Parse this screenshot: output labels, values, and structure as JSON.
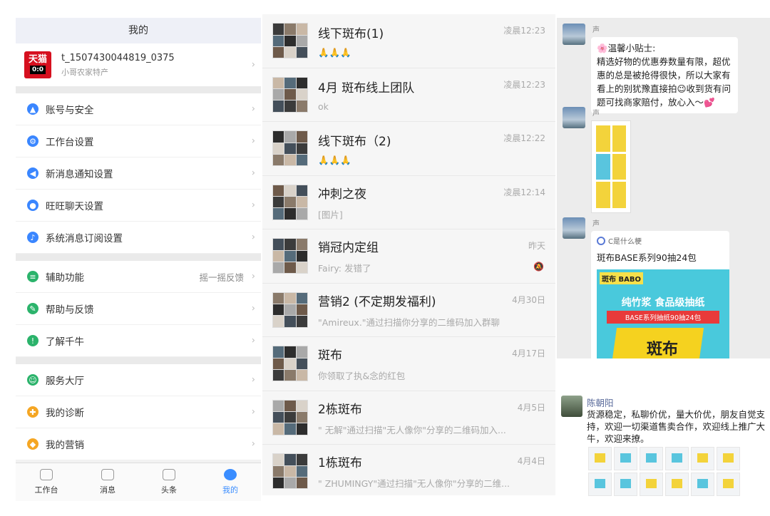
{
  "settings": {
    "title": "我的",
    "account": {
      "id": "t_1507430044819_0375",
      "subtitle": "小哥农家特产",
      "logo_text_top": "天猫",
      "logo_text_bottom": "0:0"
    },
    "group1": [
      {
        "label": "账号与安全",
        "icon": "warning-triangle-icon",
        "color": "#3a86ff"
      },
      {
        "label": "工作台设置",
        "icon": "gear-icon",
        "color": "#3a86ff"
      },
      {
        "label": "新消息通知设置",
        "icon": "speaker-icon",
        "color": "#3a86ff"
      },
      {
        "label": "旺旺聊天设置",
        "icon": "chat-bubble-icon",
        "color": "#3a86ff"
      },
      {
        "label": "系统消息订阅设置",
        "icon": "bell-icon",
        "color": "#3a86ff"
      }
    ],
    "group2": [
      {
        "label": "辅助功能",
        "icon": "assist-icon",
        "color": "#2bb36b",
        "extra": "摇一摇反馈"
      },
      {
        "label": "帮助与反馈",
        "icon": "pencil-icon",
        "color": "#2bb36b"
      },
      {
        "label": "了解千牛",
        "icon": "info-icon",
        "color": "#2bb36b"
      }
    ],
    "group3": [
      {
        "label": "服务大厅",
        "icon": "service-icon",
        "color": "#2bb36b"
      },
      {
        "label": "我的诊断",
        "icon": "diagnosis-icon",
        "color": "#f5a623"
      },
      {
        "label": "我的营销",
        "icon": "marketing-icon",
        "color": "#f5a623"
      }
    ],
    "tabs": [
      {
        "label": "工作台",
        "icon": "workbench-icon"
      },
      {
        "label": "消息",
        "icon": "message-icon"
      },
      {
        "label": "头条",
        "icon": "news-icon"
      },
      {
        "label": "我的",
        "icon": "profile-icon",
        "active": true
      }
    ]
  },
  "chats": [
    {
      "title": "线下斑布(1)",
      "preview": "🙏🙏🙏",
      "time": "凌晨12:23"
    },
    {
      "title": "4月 斑布线上团队",
      "preview": "ok",
      "time": "凌晨12:23"
    },
    {
      "title": "线下斑布（2)",
      "preview": "🙏🙏🙏",
      "time": "凌晨12:22"
    },
    {
      "title": "冲刺之夜",
      "preview": "[图片]",
      "time": "凌晨12:14"
    },
    {
      "title": "销冠内定组",
      "preview": "Fairy: 发错了",
      "time": "昨天",
      "muted": true
    },
    {
      "title": "营销2 (不定期发福利)",
      "preview": "\"Amireux.\"通过扫描你分享的二维码加入群聊",
      "time": "4月30日"
    },
    {
      "title": "斑布",
      "preview": "你领取了执&念的红包",
      "time": "4月17日"
    },
    {
      "title": "2栋斑布",
      "preview": "\" 无解\"通过扫描\"无人像你\"分享的二维码加入...",
      "time": "4月5日"
    },
    {
      "title": "1栋斑布",
      "preview": "\" ZHUMINGY\"通过扫描\"无人像你\"分享的二维...",
      "time": "4月4日"
    }
  ],
  "group_chat": {
    "sender": "声",
    "tip": "🌸温馨小贴士:\n精选好物的优惠券数量有限，超优惠的总是被抢得很快，所以大家有看上的别犹豫直接拍😉收到货有问题可找商家赔付，放心入～💕",
    "card": {
      "source": "C是什么梗",
      "title": "斑布BASE系列90抽24包",
      "promo_brand": "斑布 BABO",
      "promo_headline": "纯竹浆 食品级抽纸",
      "promo_ribbon": "BASE系列抽纸90抽24包",
      "promo_box": "斑布"
    }
  },
  "moment": {
    "name": "陈朝阳",
    "text": "货源稳定，私聊价优，量大价优，朋友自觉支持，欢迎一切渠道售卖合作，欢迎线上推广大牛，欢迎来撩。"
  }
}
